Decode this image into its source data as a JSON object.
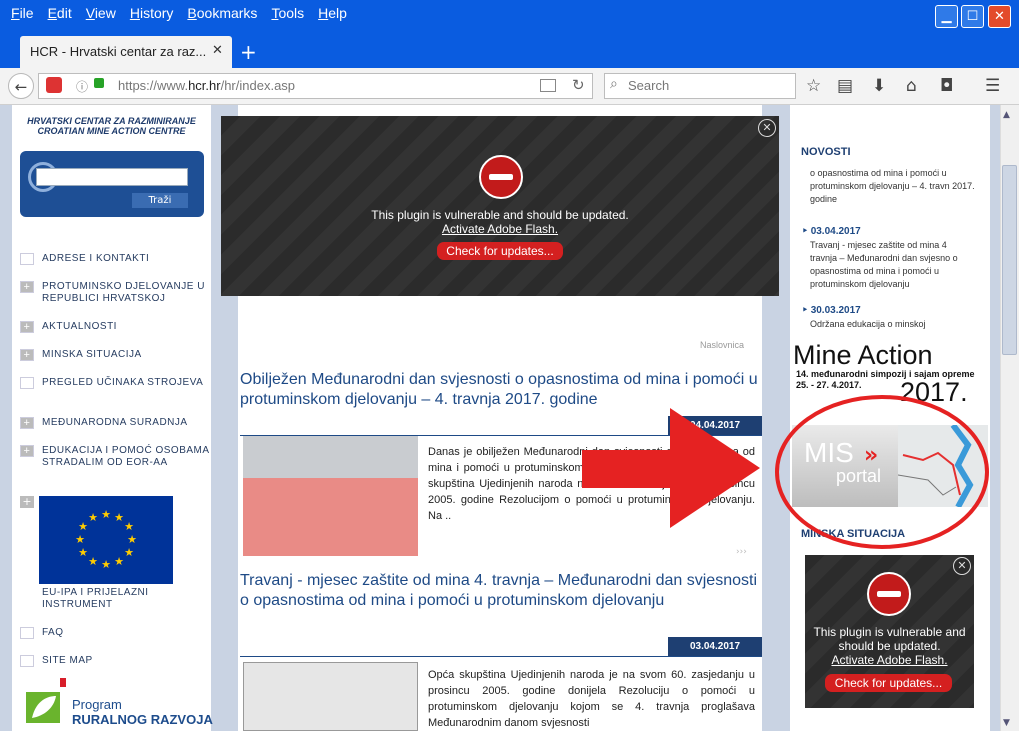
{
  "browser": {
    "menu": [
      "File",
      "Edit",
      "View",
      "History",
      "Bookmarks",
      "Tools",
      "Help"
    ],
    "tab_title": "HCR - Hrvatski centar za raz...",
    "url_prefix": "https://www.",
    "url_domain": "hcr.hr",
    "url_path": "/hr/index.asp",
    "search_placeholder": "Search"
  },
  "left": {
    "header_line1": "HRVATSKI CENTAR ZA RAZMINIRANJE",
    "header_line2": "CROATIAN MINE ACTION CENTRE",
    "search_button": "Traži",
    "nav": [
      {
        "label": "ADRESE I KONTAKTI",
        "plus": false
      },
      {
        "label": "PROTUMINSKO DJELOVANJE U REPUBLICI HRVATSKOJ",
        "plus": true
      },
      {
        "label": "AKTUALNOSTI",
        "plus": true
      },
      {
        "label": "MINSKA SITUACIJA",
        "plus": true
      },
      {
        "label": "PREGLED UČINAKA STROJEVA",
        "plus": false
      },
      {
        "label": "MEĐUNARODNA SURADNJA",
        "plus": true
      },
      {
        "label": "EDUKACIJA I POMOĆ OSOBAMA STRADALIM OD EOR-AA",
        "plus": true
      }
    ],
    "eu_label": "EU-IPA I PRIJELAZNI INSTRUMENT",
    "nav_bottom": [
      "FAQ",
      "SITE MAP"
    ],
    "rural_line1": "Program",
    "rural_line2": "RURALNOG RAZVOJA"
  },
  "flash": {
    "message": "This plugin is vulnerable and should be updated.",
    "message_side_1": "This plugin is vulnerable and",
    "message_side_2": "should be updated.",
    "link": "Activate Adobe Flash.",
    "button": "Check for updates..."
  },
  "main": {
    "breadcrumb": "Naslovnica",
    "articles": [
      {
        "title": "Obilježen Međunarodni dan svjesnosti o opasnostima od mina i pomoći u protuminskom djelovanju – 4. travnja 2017. godine",
        "date": "04.04.2017",
        "body": "Danas je obilježen Međunarodni dan svjesnosti o opasnostima od mina i pomoći u protuminskom djelovanju koji je proglasila Opća skupština Ujedinjenih naroda na svom 60. zasjedanju u prosincu 2005. godine Rezolucijom o pomoći u protuminskom djelovanju. Na .."
      },
      {
        "title": "Travanj - mjesec zaštite od mina 4. travnja – Međunarodni dan svjesnosti o opasnostima od mina i pomoći u protuminskom djelovanju",
        "date": "03.04.2017",
        "body": "Opća skupština Ujedinjenih naroda je na svom 60. zasjedanju u prosincu 2005. godine donijela Rezoluciju o pomoći u protuminskom djelovanju kojom se 4. travnja proglašava Međunarodnim danom svjesnosti"
      }
    ],
    "more": "›››"
  },
  "right": {
    "news_title": "NOVOSTI",
    "news_top": "o opasnostima od mina i pomoći u protuminskom djelovanju – 4. travn 2017. godine",
    "news_items": [
      {
        "date": "03.04.2017",
        "text": "Travanj - mjesec zaštite od mina 4 travnja – Međunarodni dan svjesno o opasnostima od mina i pomoći u protuminskom djelovanju"
      },
      {
        "date": "30.03.2017",
        "text": "Održana edukacija o minskoj"
      }
    ],
    "ma_title": "Mine Action",
    "ma_sub_1": "14. međunarodni simpozij i sajam opreme",
    "ma_sub_2": "25. - 27. 4.2017.",
    "ma_year": "2017.",
    "mis_1": "MIS",
    "mis_2": "portal",
    "minska_situacija": "MINSKA SITUACIJA"
  },
  "colors": {
    "annotation_red": "#e52222",
    "titlebar_blue": "#0a5ce0",
    "nav_dark_blue": "#1e3f72"
  }
}
